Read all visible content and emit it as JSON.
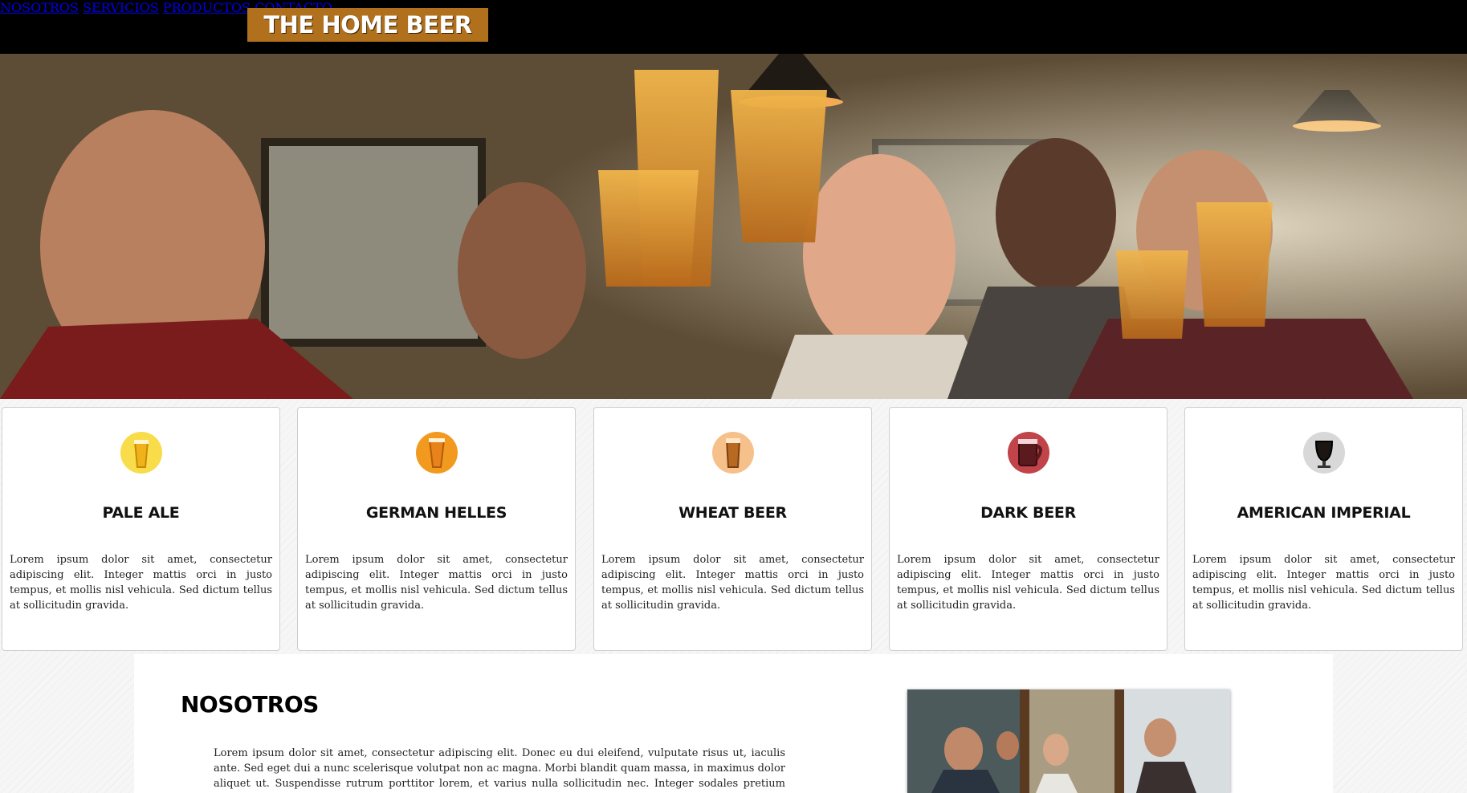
{
  "brand": {
    "logo_text": "THE HOME BEER",
    "logo_color": "#b0701c"
  },
  "nav": {
    "items": [
      "NOSOTROS",
      "SERVICIOS",
      "PRODUCTOS",
      "CONTACTO"
    ]
  },
  "cards": [
    {
      "title": "PALE ALE",
      "icon": "pale-ale-glass-icon",
      "icon_bg": "#f8dc4a",
      "text": "Lorem ipsum dolor sit amet, consectetur adipiscing elit. Integer mattis orci in justo tempus, et mollis nisl vehicula. Sed dictum tellus at sollicitudin gravida."
    },
    {
      "title": "GERMAN HELLES",
      "icon": "german-helles-glass-icon",
      "icon_bg": "#f29a1f",
      "text": "Lorem ipsum dolor sit amet, consectetur adipiscing elit. Integer mattis orci in justo tempus, et mollis nisl vehicula. Sed dictum tellus at sollicitudin gravida."
    },
    {
      "title": "WHEAT BEER",
      "icon": "wheat-beer-glass-icon",
      "icon_bg": "#f6c08a",
      "text": "Lorem ipsum dolor sit amet, consectetur adipiscing elit. Integer mattis orci in justo tempus, et mollis nisl vehicula. Sed dictum tellus at sollicitudin gravida."
    },
    {
      "title": "DARK BEER",
      "icon": "dark-beer-mug-icon",
      "icon_bg": "#c0444a",
      "text": "Lorem ipsum dolor sit amet, consectetur adipiscing elit. Integer mattis orci in justo tempus, et mollis nisl vehicula. Sed dictum tellus at sollicitudin gravida."
    },
    {
      "title": "AMERICAN IMPERIAL",
      "icon": "american-imperial-glass-icon",
      "icon_bg": "#d8d8d8",
      "text": "Lorem ipsum dolor sit amet, consectetur adipiscing elit. Integer mattis orci in justo tempus, et mollis nisl vehicula. Sed dictum tellus at sollicitudin gravida."
    }
  ],
  "about": {
    "title": "NOSOTROS",
    "text": "Lorem ipsum dolor sit amet, consectetur adipiscing elit. Donec eu dui eleifend, vulputate risus ut, iaculis ante. Sed eget dui a nunc scelerisque volutpat non ac magna. Morbi blandit quam massa, in maximus dolor aliquet ut. Suspendisse rutrum porttitor lorem, et varius nulla sollicitudin nec. Integer sodales pretium diam eget bibendum. Sed aliquet, tortor vel ultricies tincidunt, tellus nulla iaculis"
  }
}
